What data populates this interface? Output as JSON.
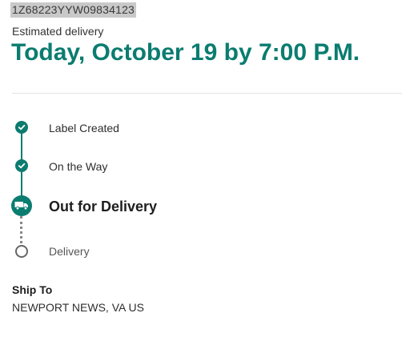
{
  "tracking": {
    "number": "1Z68223YYW09834123"
  },
  "delivery": {
    "estimated_label": "Estimated delivery",
    "estimated_value": "Today, October 19 by 7:00 P.M."
  },
  "progress": {
    "steps": [
      {
        "label": "Label Created",
        "status": "complete",
        "icon": "check-icon"
      },
      {
        "label": "On the Way",
        "status": "complete",
        "icon": "check-icon"
      },
      {
        "label": "Out for Delivery",
        "status": "current",
        "icon": "truck-icon"
      },
      {
        "label": "Delivery",
        "status": "pending",
        "icon": "empty-circle-icon"
      }
    ]
  },
  "ship_to": {
    "label": "Ship To",
    "value": "NEWPORT NEWS, VA US"
  },
  "colors": {
    "accent": "#0b7c70",
    "pending": "#666666",
    "highlight": "#c9c9c9"
  }
}
